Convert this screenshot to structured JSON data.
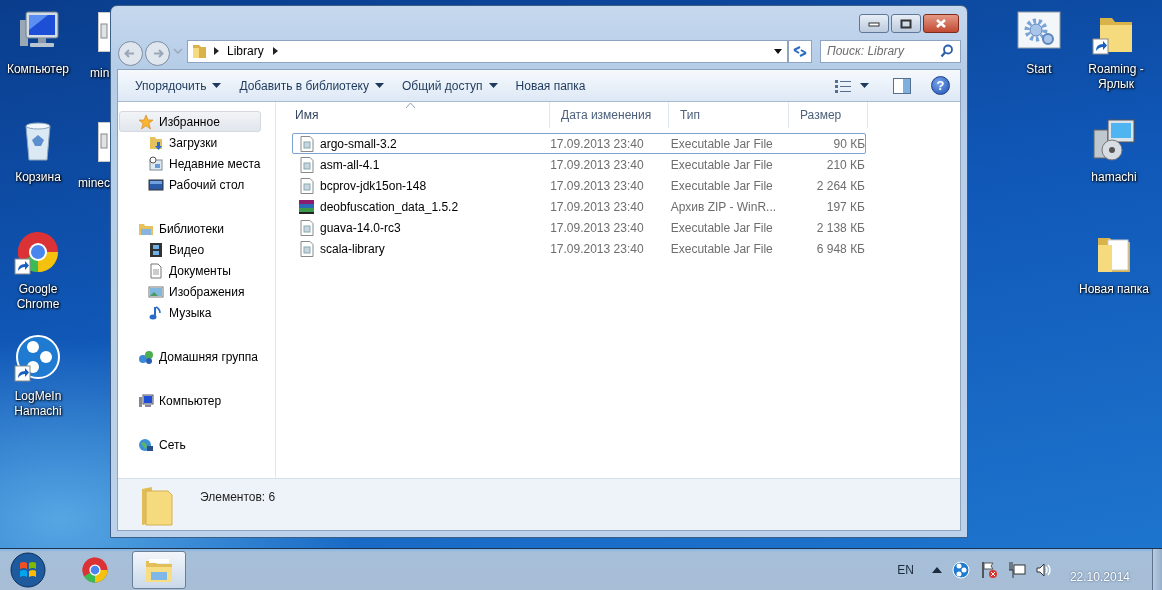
{
  "desktop": {
    "left_icons": [
      {
        "label": "Компьютер",
        "kind": "computer",
        "shortcut": false
      },
      {
        "label": "Корзина",
        "kind": "recycle-bin",
        "shortcut": false
      },
      {
        "label": "Google Chrome",
        "kind": "chrome",
        "shortcut": true
      },
      {
        "label": "LogMeIn Hamachi",
        "kind": "hamachi",
        "shortcut": true
      }
    ],
    "covered_icons": [
      {
        "label": "min"
      },
      {
        "label": "minec"
      }
    ],
    "right_icons": [
      {
        "label": "Start",
        "kind": "settings-window",
        "shortcut": false
      },
      {
        "label": "Roaming - Ярлык",
        "kind": "folder",
        "shortcut": true
      },
      {
        "label": "hamachi",
        "kind": "installer",
        "shortcut": false
      },
      {
        "label": "Новая папка",
        "kind": "folder-papers",
        "shortcut": false
      }
    ]
  },
  "explorer": {
    "address": {
      "path": [
        "Library"
      ]
    },
    "search": {
      "placeholder": "Поиск: Library"
    },
    "toolbar": [
      {
        "label": "Упорядочить",
        "dropdown": true
      },
      {
        "label": "Добавить в библиотеку",
        "dropdown": true
      },
      {
        "label": "Общий доступ",
        "dropdown": true
      },
      {
        "label": "Новая папка",
        "dropdown": false
      }
    ],
    "help": "?",
    "navigation": [
      {
        "label": "Избранное",
        "kind": "star",
        "selected": true,
        "children": [
          {
            "label": "Загрузки",
            "kind": "downloads",
            "selected": false
          },
          {
            "label": "Недавние места",
            "kind": "recent",
            "selected": false
          },
          {
            "label": "Рабочий стол",
            "kind": "desktop",
            "selected": false
          }
        ]
      },
      {
        "label": "Библиотеки",
        "kind": "libraries",
        "selected": false,
        "children": [
          {
            "label": "Видео",
            "kind": "video",
            "selected": false
          },
          {
            "label": "Документы",
            "kind": "documents",
            "selected": false
          },
          {
            "label": "Изображения",
            "kind": "pictures",
            "selected": false
          },
          {
            "label": "Музыка",
            "kind": "music",
            "selected": false
          }
        ]
      },
      {
        "label": "Домашняя группа",
        "kind": "homegroup",
        "selected": false
      },
      {
        "label": "Компьютер",
        "kind": "computer",
        "selected": false
      },
      {
        "label": "Сеть",
        "kind": "network",
        "selected": false
      }
    ],
    "columns": [
      {
        "label": "Имя",
        "sorted": true
      },
      {
        "label": "Дата изменения",
        "sorted": false
      },
      {
        "label": "Тип",
        "sorted": false
      },
      {
        "label": "Размер",
        "sorted": false
      }
    ],
    "files": [
      {
        "name": "argo-small-3.2",
        "modified": "17.09.2013 23:40",
        "type": "Executable Jar File",
        "size": "90 КБ",
        "kind": "jar",
        "focused": true
      },
      {
        "name": "asm-all-4.1",
        "modified": "17.09.2013 23:40",
        "type": "Executable Jar File",
        "size": "210 КБ",
        "kind": "jar",
        "focused": false
      },
      {
        "name": "bcprov-jdk15on-148",
        "modified": "17.09.2013 23:40",
        "type": "Executable Jar File",
        "size": "2 264 КБ",
        "kind": "jar",
        "focused": false
      },
      {
        "name": "deobfuscation_data_1.5.2",
        "modified": "17.09.2013 23:40",
        "type": "Архив ZIP - WinR...",
        "size": "197 КБ",
        "kind": "archive",
        "focused": false
      },
      {
        "name": "guava-14.0-rc3",
        "modified": "17.09.2013 23:40",
        "type": "Executable Jar File",
        "size": "2 138 КБ",
        "kind": "jar",
        "focused": false
      },
      {
        "name": "scala-library",
        "modified": "17.09.2013 23:40",
        "type": "Executable Jar File",
        "size": "6 948 КБ",
        "kind": "jar",
        "focused": false
      }
    ],
    "details": "Элементов: 6"
  },
  "taskbar": {
    "apps": [
      {
        "kind": "chrome",
        "active": false
      },
      {
        "kind": "explorer",
        "active": true
      }
    ],
    "language": "EN",
    "date": "22.10.2014"
  }
}
